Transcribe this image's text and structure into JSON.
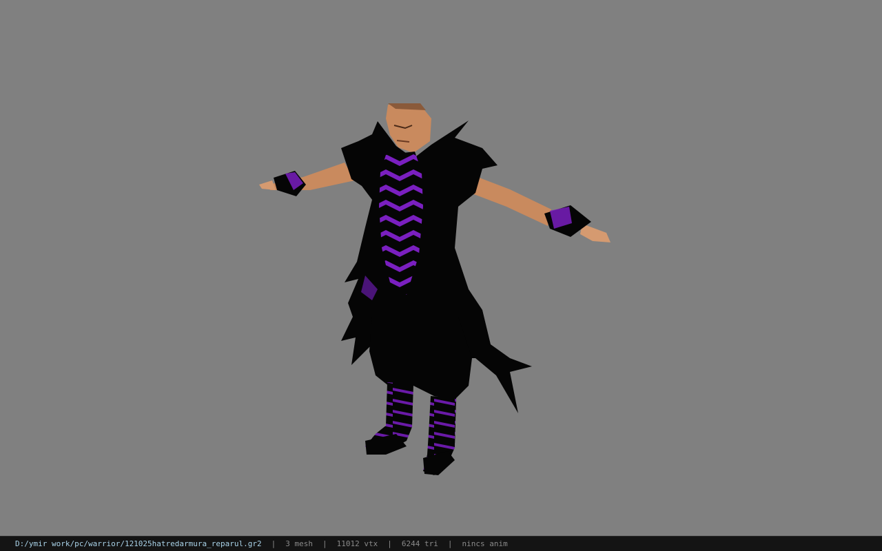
{
  "viewer": {
    "background_color": "#808080"
  },
  "status": {
    "file_path": "D:/ymir work/pc/warrior/121025hatredarmura_reparul.gr2",
    "separator": "|",
    "mesh": "3 mesh",
    "vertices": "11012 vtx",
    "triangles": "6244 tri",
    "animation": "nincs anim"
  },
  "colors": {
    "skin": "#c98a5e",
    "armor_black": "#050505",
    "armor_purple": "#7a1fc0",
    "status_bg": "#141414",
    "path_text": "#a9d2e8"
  }
}
